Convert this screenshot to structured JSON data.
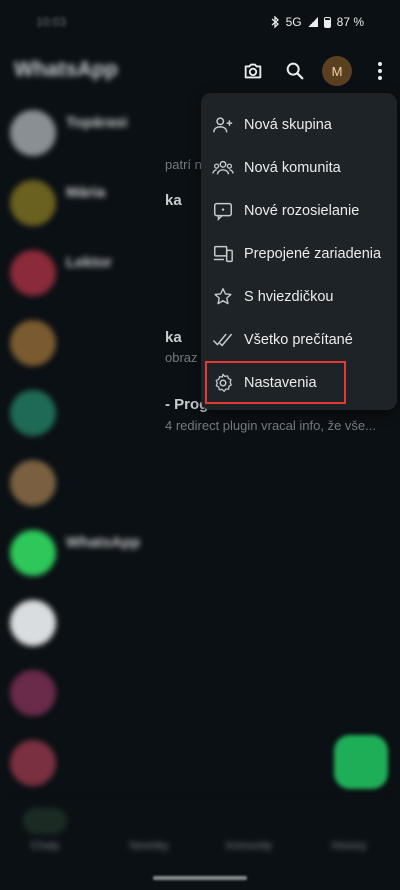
{
  "statusbar": {
    "time": "10:03",
    "network": "5G",
    "battery": "87 %"
  },
  "appbar": {
    "title": "WhatsApp",
    "avatar_initial": "M"
  },
  "chats": [
    {
      "name": "Topárasi",
      "preview": "",
      "time": "",
      "color": "#8a8f94"
    },
    {
      "name": "Mária",
      "preview": "",
      "time": "",
      "color": "#6a6020"
    },
    {
      "name": "Lektor",
      "preview": "",
      "time": "",
      "color": "#8a2a3a"
    },
    {
      "name": "",
      "preview": "",
      "time": "",
      "color": "#7a5a30"
    },
    {
      "name": "",
      "preview": "",
      "time": "",
      "color": "#1f6a56"
    },
    {
      "name": "",
      "preview": "",
      "time": "",
      "color": "#7a6040"
    },
    {
      "name": "WhatsApp",
      "preview": "",
      "time": "",
      "color": "#2ec85a"
    },
    {
      "name": "",
      "preview": "",
      "time": "",
      "color": "#dadde0"
    },
    {
      "name": "",
      "preview": "",
      "time": "",
      "color": "#6a2a4a"
    },
    {
      "name": "",
      "preview": "",
      "time": "",
      "color": "#7a3040"
    }
  ],
  "peeks": {
    "p1": "patrí n",
    "p2": "ka",
    "p3": "ka",
    "p4": "obraz",
    "p5": "- Progra",
    "p6": "4 redirect plugin vracal info, že vše..."
  },
  "menu": [
    {
      "label": "Nová skupina",
      "icon": "new-group-icon"
    },
    {
      "label": "Nová komunita",
      "icon": "new-community-icon"
    },
    {
      "label": "Nové rozosielanie",
      "icon": "new-broadcast-icon"
    },
    {
      "label": "Prepojené zariadenia",
      "icon": "linked-devices-icon"
    },
    {
      "label": "S hviezdičkou",
      "icon": "star-icon"
    },
    {
      "label": "Všetko prečítané",
      "icon": "read-all-icon"
    },
    {
      "label": "Nastavenia",
      "icon": "settings-icon"
    }
  ],
  "bottomnav": [
    {
      "label": "Chaty"
    },
    {
      "label": "Novinky"
    },
    {
      "label": "Komunity"
    },
    {
      "label": "Hovory"
    }
  ],
  "colors": {
    "menu_bg": "#1e2327",
    "highlight": "#e53935",
    "accent": "#1fae58"
  }
}
